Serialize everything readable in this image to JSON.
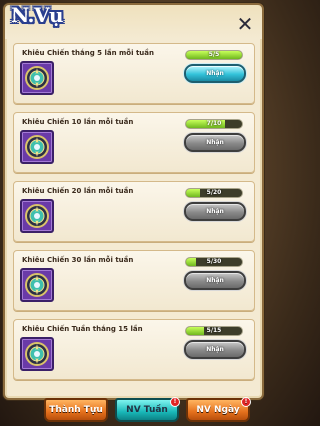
{
  "window": {
    "title": "N.Vụ",
    "close_icon": "close-icon"
  },
  "quests": [
    {
      "title": "Khiêu Chiến thắng 5 lần mỗi tuần",
      "progress_text": "5/5",
      "progress": 1.0,
      "button": "Nhận",
      "state": "active"
    },
    {
      "title": "Khiêu Chiến 10 lần mỗi tuần",
      "progress_text": "7/10",
      "progress": 0.7,
      "button": "Nhận",
      "state": "disabled"
    },
    {
      "title": "Khiêu Chiến 20 lần mỗi tuần",
      "progress_text": "5/20",
      "progress": 0.25,
      "button": "Nhận",
      "state": "disabled"
    },
    {
      "title": "Khiêu Chiến 30 lần mỗi tuần",
      "progress_text": "5/30",
      "progress": 0.17,
      "button": "Nhận",
      "state": "disabled"
    },
    {
      "title": "Khiêu Chiến Tuần thắng 15 lần",
      "progress_text": "5/15",
      "progress": 0.33,
      "button": "Nhận",
      "state": "disabled"
    }
  ],
  "tabs": [
    {
      "label": "Thành Tựu",
      "style": "orange",
      "badge": ""
    },
    {
      "label": "NV Tuần",
      "style": "teal",
      "badge": "!"
    },
    {
      "label": "NV Ngày",
      "style": "orange",
      "badge": "!"
    }
  ],
  "colors": {
    "panel": "#f4ead2",
    "claim_active": "#33c3da",
    "claim_disabled": "#8a8a8a",
    "progress_fill": "#6fb81e",
    "reward_frame": "#6a3aa8"
  },
  "reward_icon": "compass-medal-icon"
}
